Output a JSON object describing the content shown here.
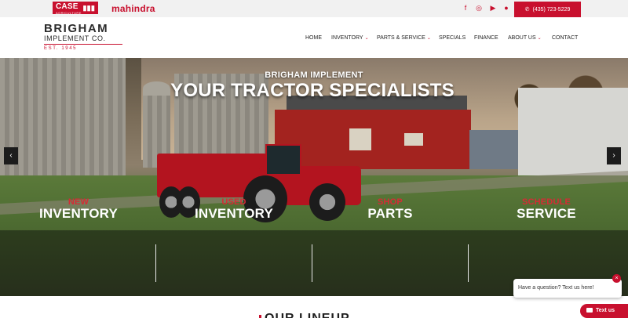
{
  "topbar": {
    "brands": {
      "case_name": "CASE",
      "case_sub": "AGRICULTURE",
      "mahindra": "mahindra"
    },
    "social_icons": [
      "facebook-icon",
      "instagram-icon",
      "youtube-icon",
      "location-pin-icon"
    ],
    "phone": "(435) 723-5229",
    "accent_color": "#c8102e"
  },
  "logo": {
    "name": "BRIGHAM",
    "sub": "IMPLEMENT CO.",
    "est": "EST. 1945"
  },
  "nav": [
    {
      "label": "HOME",
      "has_menu": false
    },
    {
      "label": "INVENTORY",
      "has_menu": true
    },
    {
      "label": "PARTS & SERVICE",
      "has_menu": true
    },
    {
      "label": "SPECIALS",
      "has_menu": false
    },
    {
      "label": "FINANCE",
      "has_menu": false
    },
    {
      "label": "ABOUT US",
      "has_menu": true
    },
    {
      "label": "CONTACT",
      "has_menu": false
    }
  ],
  "hero": {
    "kicker": "BRIGHAM IMPLEMENT",
    "title": "YOUR TRACTOR SPECIALISTS",
    "prev_arrow": "‹",
    "next_arrow": "›"
  },
  "cta": [
    {
      "top": "NEW",
      "bottom": "INVENTORY"
    },
    {
      "top": "USED",
      "bottom": "INVENTORY"
    },
    {
      "top": "SHOP",
      "bottom": "PARTS"
    },
    {
      "top": "SCHEDULE",
      "bottom": "SERVICE"
    }
  ],
  "lineup": {
    "title": "OUR LINEUP"
  },
  "chat": {
    "prompt": "Have a question? Text us here!",
    "close": "×",
    "text_us": "Text us"
  }
}
